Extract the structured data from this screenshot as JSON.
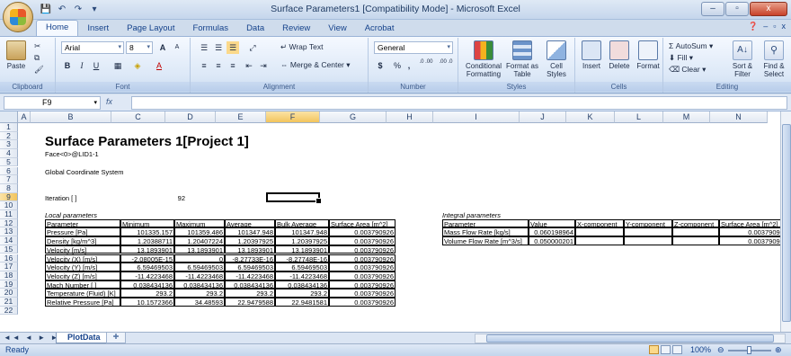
{
  "window": {
    "title": "Surface Parameters1  [Compatibility Mode] - Microsoft Excel",
    "buttons": [
      "–",
      "▫",
      "x"
    ]
  },
  "ribbon": {
    "tabs": [
      "Home",
      "Insert",
      "Page Layout",
      "Formulas",
      "Data",
      "Review",
      "View",
      "Acrobat"
    ],
    "active_tab": "Home",
    "clipboard": {
      "label": "Clipboard",
      "paste": "Paste"
    },
    "font": {
      "label": "Font",
      "name": "Arial",
      "size": "8",
      "bold": "B",
      "italic": "I",
      "underline": "U",
      "grow": "A",
      "shrink": "A"
    },
    "alignment": {
      "label": "Alignment",
      "wrap": "Wrap Text",
      "merge": "Merge & Center"
    },
    "number": {
      "label": "Number",
      "format": "General",
      "currency": "$",
      "percent": "%",
      "comma": ",",
      "inc": ".0 .00",
      "dec": ".00 .0"
    },
    "styles": {
      "label": "Styles",
      "conditional": "Conditional Formatting",
      "format_table": "Format as Table",
      "cell_styles": "Cell Styles"
    },
    "cells": {
      "label": "Cells",
      "insert": "Insert",
      "delete": "Delete",
      "format": "Format"
    },
    "editing": {
      "label": "Editing",
      "autosum": "AutoSum",
      "fill": "Fill",
      "clear": "Clear",
      "sort": "Sort & Filter",
      "find": "Find & Select"
    }
  },
  "formula_bar": {
    "name_box": "F9",
    "fx": "fx",
    "content": ""
  },
  "columns": [
    "A",
    "B",
    "C",
    "D",
    "E",
    "F",
    "G",
    "H",
    "I",
    "J",
    "K",
    "L",
    "M",
    "N"
  ],
  "selected_column": "F",
  "rows": [
    "1",
    "2",
    "3",
    "4",
    "5",
    "6",
    "7",
    "8",
    "9",
    "10",
    "11",
    "12",
    "13",
    "14",
    "15",
    "16",
    "17",
    "18",
    "19",
    "20",
    "21",
    "22"
  ],
  "selected_row": "9",
  "sheet": {
    "title": "Surface Parameters 1[Project 1]",
    "face": "Face<0>@LID1-1",
    "coord_system": "Global Coordinate System",
    "iteration_label": "Iteration [ ]",
    "iteration_value": "92",
    "local_label": "Local parameters",
    "integral_label": "Integral parameters",
    "local_headers": [
      "Parameter",
      "Minimum",
      "Maximum",
      "Average",
      "Bulk Average",
      "Surface Area [m^2]"
    ],
    "local_rows": [
      [
        "Pressure [Pa]",
        "101335.157",
        "101359.486",
        "101347.948",
        "101347.948",
        "0.003790926"
      ],
      [
        "Density [kg/m^3]",
        "1.20388711",
        "1.20407224",
        "1.20397925",
        "1.20397925",
        "0.003790926"
      ],
      [
        "Velocity [m/s]",
        "13.1893901",
        "13.1893901",
        "13.1893901",
        "13.1893901",
        "0.003790926"
      ],
      [
        "Velocity (X) [m/s]",
        "-2.08005E-15",
        "0",
        "-8.27733E-16",
        "-8.27748E-16",
        "0.003790926"
      ],
      [
        "Velocity (Y) [m/s]",
        "6.59469503",
        "6.59469503",
        "6.59469503",
        "6.59469503",
        "0.003790926"
      ],
      [
        "Velocity (Z) [m/s]",
        "-11.4223468",
        "-11.4223468",
        "-11.4223468",
        "-11.4223468",
        "0.003790926"
      ],
      [
        "Mach Number [ ]",
        "0.038434136",
        "0.038434136",
        "0.038434136",
        "0.038434136",
        "0.003790926"
      ],
      [
        "Temperature (Fluid) [K]",
        "293.2",
        "293.2",
        "293.2",
        "293.2",
        "0.003790926"
      ],
      [
        "Relative Pressure [Pa]",
        "10.1572366",
        "34.48593",
        "22.9479588",
        "22.9481581",
        "0.003790926"
      ]
    ],
    "integral_headers": [
      "Parameter",
      "Value",
      "X-component",
      "Y-component",
      "Z-component",
      "Surface Area [m^2]"
    ],
    "integral_rows": [
      [
        "Mass Flow Rate [kg/s]",
        "0.060198964",
        "",
        "",
        "",
        "0.003790926"
      ],
      [
        "Volume Flow Rate [m^3/s]",
        "0.050000201",
        "",
        "",
        "",
        "0.003790926"
      ]
    ]
  },
  "sheet_tabs": {
    "nav": "◄◄ ◄ ► ►►",
    "active": "PlotData"
  },
  "status": {
    "text": "Ready",
    "zoom": "100%"
  }
}
